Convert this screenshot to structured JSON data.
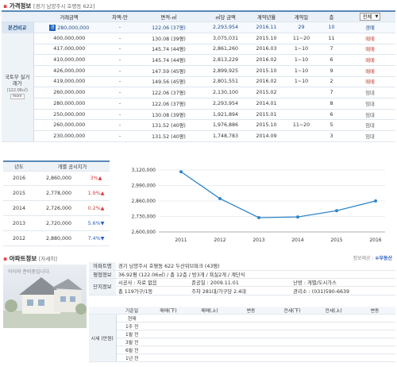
{
  "price_section": {
    "title": "가격정보",
    "subtitle": "[경기 남양주시 호평동 622]",
    "headers": [
      "거래금액",
      "차액-만",
      "면적-㎡",
      "㎡당 금액",
      "계약년월",
      "계약일",
      "층"
    ],
    "filter_value": "전체",
    "base_label": "본건비교",
    "side_label": "국토부 실거래가",
    "side_sub": "(122.06㎡)",
    "more_label": "more",
    "rows": [
      {
        "amount": "280,000,000",
        "diff": "-",
        "area": "122.06 (37평)",
        "per_m2": "2,293,954",
        "ym": "2016.11",
        "day": "29",
        "floor": "10",
        "type": "경매"
      },
      {
        "amount": "400,000,000",
        "diff": "-",
        "area": "130.08 (39평)",
        "per_m2": "3,075,031",
        "ym": "2015.10",
        "day": "11~20",
        "floor": "11",
        "type": "매매"
      },
      {
        "amount": "417,000,000",
        "diff": "-",
        "area": "145.74 (44평)",
        "per_m2": "2,861,260",
        "ym": "2016.03",
        "day": "1~10",
        "floor": "7",
        "type": "매매"
      },
      {
        "amount": "410,000,000",
        "diff": "-",
        "area": "145.74 (44평)",
        "per_m2": "2,813,229",
        "ym": "2016.02",
        "day": "1~10",
        "floor": "6",
        "type": "매매"
      },
      {
        "amount": "426,000,000",
        "diff": "-",
        "area": "147.59 (45평)",
        "per_m2": "2,899,925",
        "ym": "2015.10",
        "day": "1~10",
        "floor": "9",
        "type": "매매"
      },
      {
        "amount": "419,000,000",
        "diff": "-",
        "area": "149.56 (45평)",
        "per_m2": "2,801,551",
        "ym": "2016.02",
        "day": "1~10",
        "floor": "2",
        "type": "매매"
      },
      {
        "amount": "260,000,000",
        "diff": "-",
        "area": "122.06 (37평)",
        "per_m2": "2,130,100",
        "ym": "2015.02",
        "day": "",
        "floor": "7",
        "type": "임대"
      },
      {
        "amount": "280,000,000",
        "diff": "-",
        "area": "122.06 (37평)",
        "per_m2": "2,293,954",
        "ym": "2014.01",
        "day": "",
        "floor": "8",
        "type": "임대"
      },
      {
        "amount": "250,000,000",
        "diff": "-",
        "area": "130.08 (39평)",
        "per_m2": "1,921,894",
        "ym": "2015.01",
        "day": "",
        "floor": "6",
        "type": "임대"
      },
      {
        "amount": "260,000,000",
        "diff": "-",
        "area": "131.52 (40평)",
        "per_m2": "1,976,886",
        "ym": "2015.10",
        "day": "11~20",
        "floor": "5",
        "type": "임대"
      },
      {
        "amount": "230,000,000",
        "diff": "-",
        "area": "131.52 (40평)",
        "per_m2": "1,748,783",
        "ym": "2014.09",
        "day": "",
        "floor": "3",
        "type": "임대"
      }
    ]
  },
  "official_price": {
    "headers": [
      "년도",
      "개별 공시지가"
    ],
    "rows": [
      {
        "year": "2016",
        "price": "2,860,000",
        "change": "3%",
        "dir": "up"
      },
      {
        "year": "2015",
        "price": "2,778,000",
        "change": "1.9%",
        "dir": "up"
      },
      {
        "year": "2014",
        "price": "2,726,000",
        "change": "0.2%",
        "dir": "up"
      },
      {
        "year": "2013",
        "price": "2,720,000",
        "change": "5.6%",
        "dir": "down"
      },
      {
        "year": "2012",
        "price": "2,880,000",
        "change": "7.4%",
        "dir": "down"
      }
    ]
  },
  "chart_data": {
    "type": "line",
    "x": [
      "2011",
      "2012",
      "2013",
      "2014",
      "2015",
      "2016"
    ],
    "values": [
      3105000,
      2880000,
      2720000,
      2726000,
      2778000,
      2860000
    ],
    "yticks": [
      "3,120,000",
      "2,990,000",
      "2,860,000",
      "2,730,000",
      "2,600,000"
    ],
    "ylim": [
      2600000,
      3120000
    ],
    "color": "#2f86c9"
  },
  "apt_section": {
    "title": "아파트정보",
    "subtitle": "[자세히]",
    "source_label": "정보제공 :",
    "source_logo": "부동산",
    "photo_caption": "아이와 준비중입니다.",
    "info": [
      {
        "label": "아파트명",
        "value": "경기 남양주시 호평동 622 두산위브파크 (43평)"
      },
      {
        "label": "평형정보",
        "value": "36.92평 (122.06㎡) / 총 12층 / 방3개 / 욕실2개 / 계단식"
      },
      {
        "label": "단지정보",
        "value": "시공사 : 자료 없음",
        "label2": "준공일 : 2009.11.01",
        "value2": "난방 : 개별/도시가스"
      },
      {
        "label": "",
        "value": "총 119가구/1동",
        "label2": "주차 281대/가구당 2.4대",
        "value2": "관리소 : (031)590-6639"
      }
    ],
    "quote_headers": [
      "기준일",
      "매매(下)",
      "매매(上)",
      "변동",
      "전세(下)",
      "전세(上)",
      "변동"
    ],
    "quote_side": "시세 (만원)",
    "quote_rows": [
      "현재",
      "1주 전",
      "1월 전",
      "3월 전",
      "6월 전",
      "1년 전"
    ]
  }
}
